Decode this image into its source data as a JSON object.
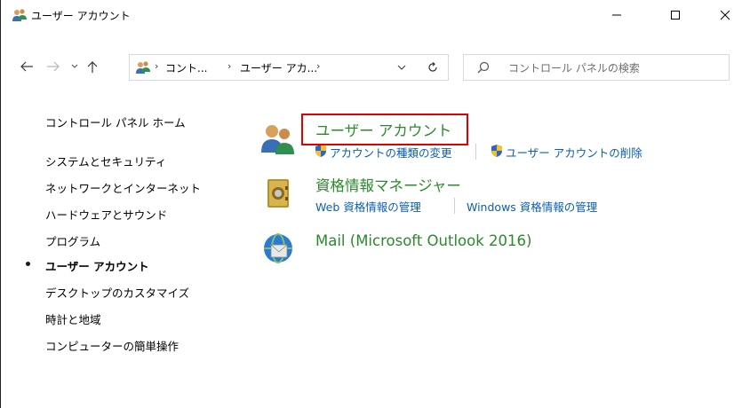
{
  "window": {
    "title": "ユーザー アカウント",
    "minimize_symbol": "—",
    "maximize_symbol": "☐",
    "close_symbol": "✕"
  },
  "navigation": {
    "back_icon": "left-arrow-icon",
    "forward_icon": "right-arrow-icon",
    "recent_icon": "chevron-down-icon",
    "up_icon": "up-arrow-icon"
  },
  "address_bar": {
    "crumbs": [
      "コント...",
      "ユーザー アカ..."
    ],
    "separator": "›"
  },
  "search": {
    "placeholder": "コントロール パネルの検索"
  },
  "left_nav": {
    "items": [
      "コントロール パネル ホーム",
      "システムとセキュリティ",
      "ネットワークとインターネット",
      "ハードウェアとサウンド",
      "プログラム",
      "ユーザー アカウント",
      "デスクトップのカスタマイズ",
      "時計と地域",
      "コンピューターの簡単操作"
    ],
    "current_index": 5
  },
  "main": {
    "categories": [
      {
        "title": "ユーザー アカウント",
        "icon": "users-icon",
        "links": [
          "アカウントの種類の変更",
          "ユーザー アカウントの削除"
        ]
      },
      {
        "title": "資格情報マネージャー",
        "icon": "credential-vault-icon",
        "links": [
          "Web 資格情報の管理",
          "Windows 資格情報の管理"
        ]
      },
      {
        "title": "Mail (Microsoft Outlook 2016)",
        "icon": "mail-icon",
        "links": []
      }
    ]
  },
  "colors": {
    "category_title": "#2b8a2b",
    "link": "#0a5fb4",
    "highlight_border": "#e00000"
  }
}
